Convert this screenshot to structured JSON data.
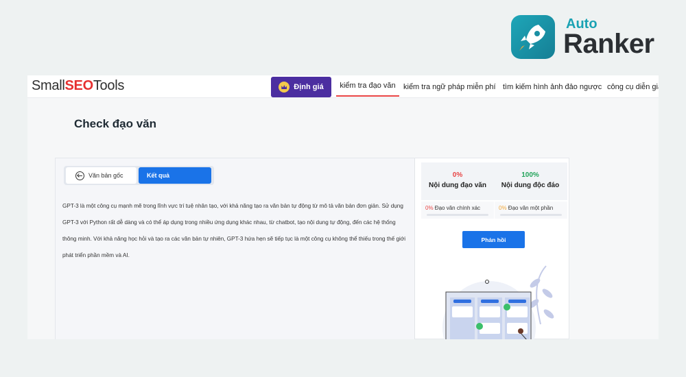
{
  "watermark": {
    "auto": "Auto",
    "ranker": "Ranker",
    "brand_color": "#1aa2b3"
  },
  "header": {
    "logo": {
      "part1": "Small",
      "part2": "SEO",
      "part3": "Tools"
    },
    "pricing_label": "Định giá",
    "nav": [
      {
        "label": "kiểm tra đạo văn",
        "active": true
      },
      {
        "label": "kiểm tra ngữ pháp miễn phí",
        "active": false
      },
      {
        "label": "tìm kiếm hình ảnh đảo ngược",
        "active": false
      },
      {
        "label": "công cụ diễn giả",
        "active": false
      }
    ]
  },
  "page_title": "Check đạo văn",
  "tabs": {
    "original": "Văn bản gốc",
    "result": "Kết quả"
  },
  "content": "GPT-3 là một công cụ mạnh mẽ trong lĩnh vực trí tuệ nhân tạo, với khả năng tạo ra văn bản tự động từ mô tả văn bản đơn giản. Sử dụng GPT-3 với Python rất dễ dàng và có thể áp dụng trong nhiều ứng dụng khác nhau, từ chatbot, tạo nội dung tự động, đến các hệ thống thông minh. Với khả năng học hỏi và tạo ra các văn bản tự nhiên, GPT-3 hứa hẹn sẽ tiếp tục là một công cụ không thể thiếu trong thế giới phát triển phần mềm và AI.",
  "stats": {
    "plagiarism": {
      "value": "0%",
      "label": "Nội dung đạo văn",
      "color": "#e84545"
    },
    "unique": {
      "value": "100%",
      "label": "Nội dung độc đáo",
      "color": "#22a35a"
    },
    "exact": {
      "value": "0%",
      "label": "Đạo văn chính xác"
    },
    "partial": {
      "value": "0%",
      "label": "Đạo văn một phần"
    }
  },
  "feedback_label": "Phản hồi"
}
